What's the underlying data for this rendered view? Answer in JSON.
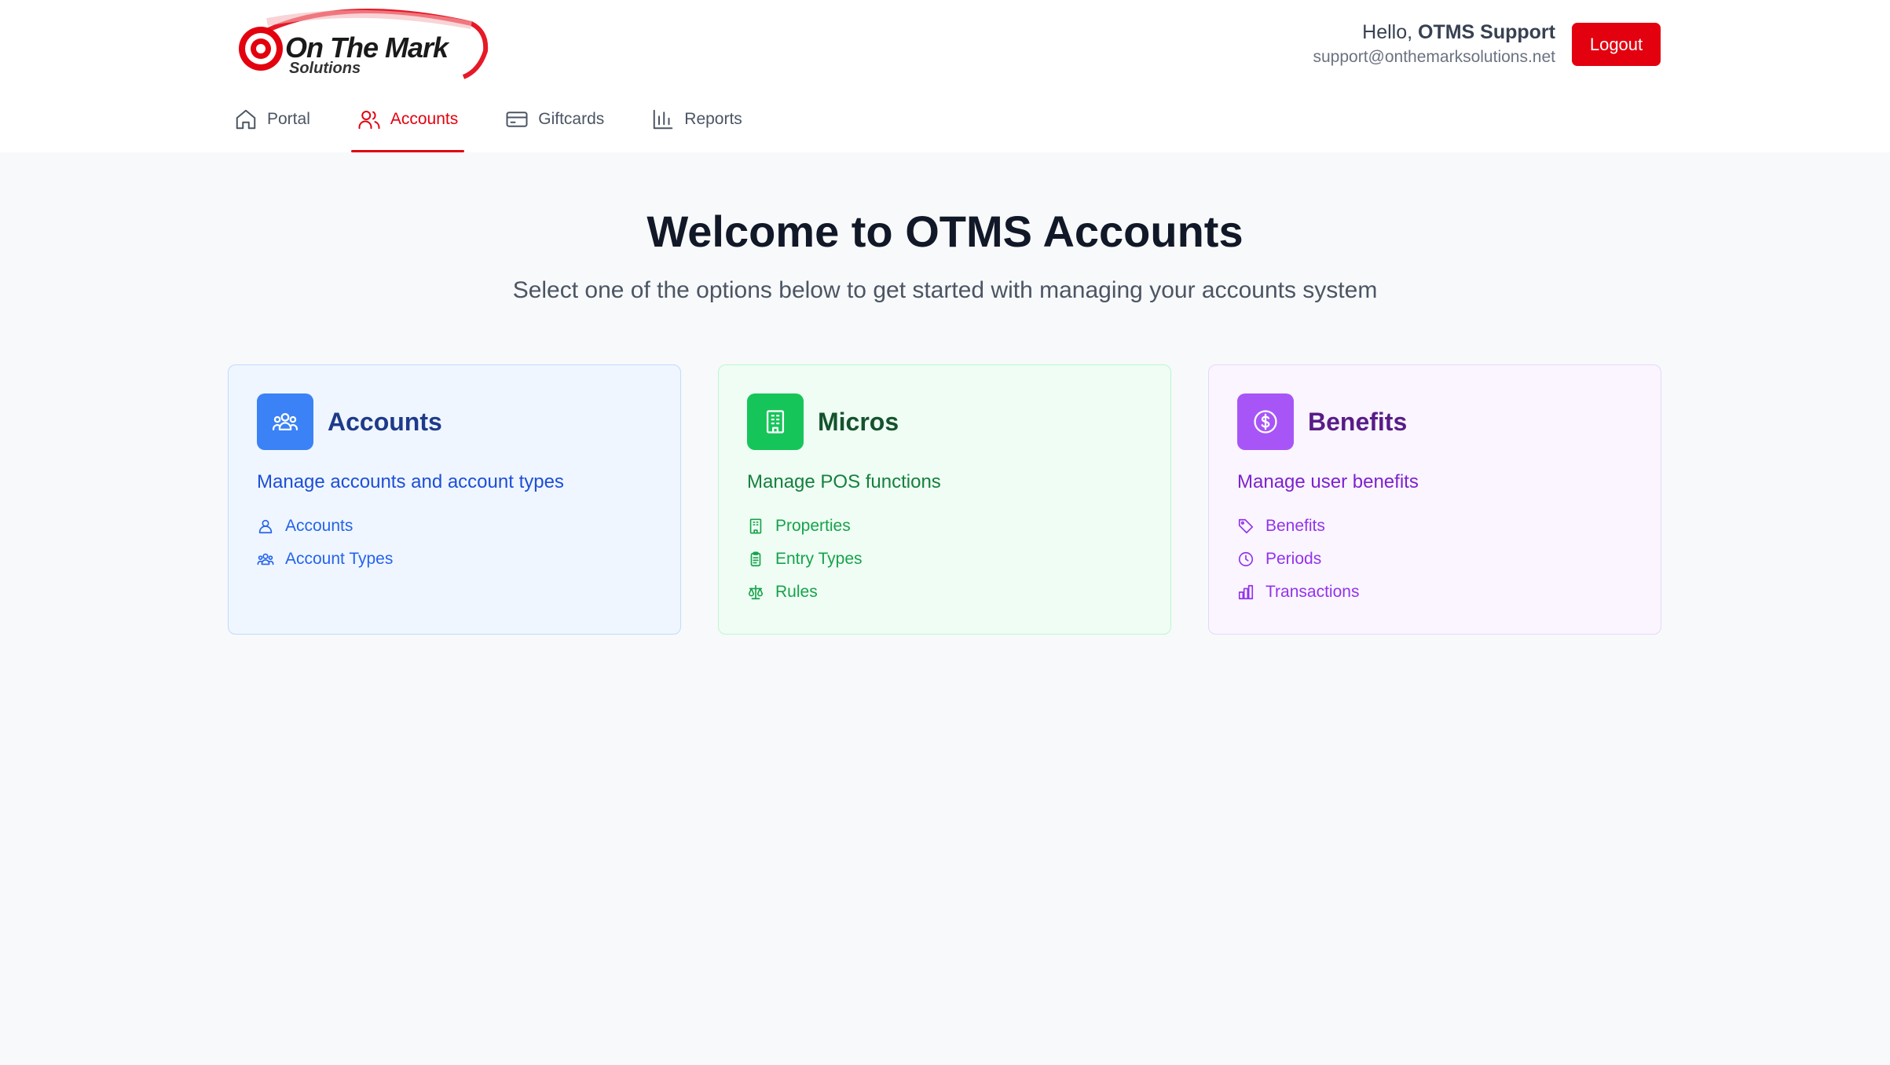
{
  "brand": {
    "logo_name": "On The Mark",
    "logo_sub": "Solutions",
    "accent_color": "#e3000f"
  },
  "user": {
    "greeting": "Hello,",
    "name": "OTMS Support",
    "email": "support@onthemarksolutions.net",
    "logout_label": "Logout"
  },
  "nav": {
    "items": [
      {
        "label": "Portal",
        "icon": "home-icon",
        "active": false
      },
      {
        "label": "Accounts",
        "icon": "users-icon",
        "active": true
      },
      {
        "label": "Giftcards",
        "icon": "credit-card-icon",
        "active": false
      },
      {
        "label": "Reports",
        "icon": "bar-chart-icon",
        "active": false
      }
    ]
  },
  "hero": {
    "title": "Welcome to OTMS Accounts",
    "subtitle": "Select one of the options below to get started with managing your accounts system"
  },
  "cards": [
    {
      "title": "Accounts",
      "icon": "user-group-icon",
      "description": "Manage accounts and account types",
      "color": "#3b82f6",
      "links": [
        {
          "label": "Accounts",
          "icon": "user-icon"
        },
        {
          "label": "Account Types",
          "icon": "user-group-icon"
        }
      ]
    },
    {
      "title": "Micros",
      "icon": "building-icon",
      "description": "Manage POS functions",
      "color": "#16c55a",
      "links": [
        {
          "label": "Properties",
          "icon": "building-icon"
        },
        {
          "label": "Entry Types",
          "icon": "clipboard-icon"
        },
        {
          "label": "Rules",
          "icon": "scale-icon"
        }
      ]
    },
    {
      "title": "Benefits",
      "icon": "dollar-circle-icon",
      "description": "Manage user benefits",
      "color": "#a855f7",
      "links": [
        {
          "label": "Benefits",
          "icon": "tag-icon"
        },
        {
          "label": "Periods",
          "icon": "clock-icon"
        },
        {
          "label": "Transactions",
          "icon": "chart-icon"
        }
      ]
    }
  ]
}
